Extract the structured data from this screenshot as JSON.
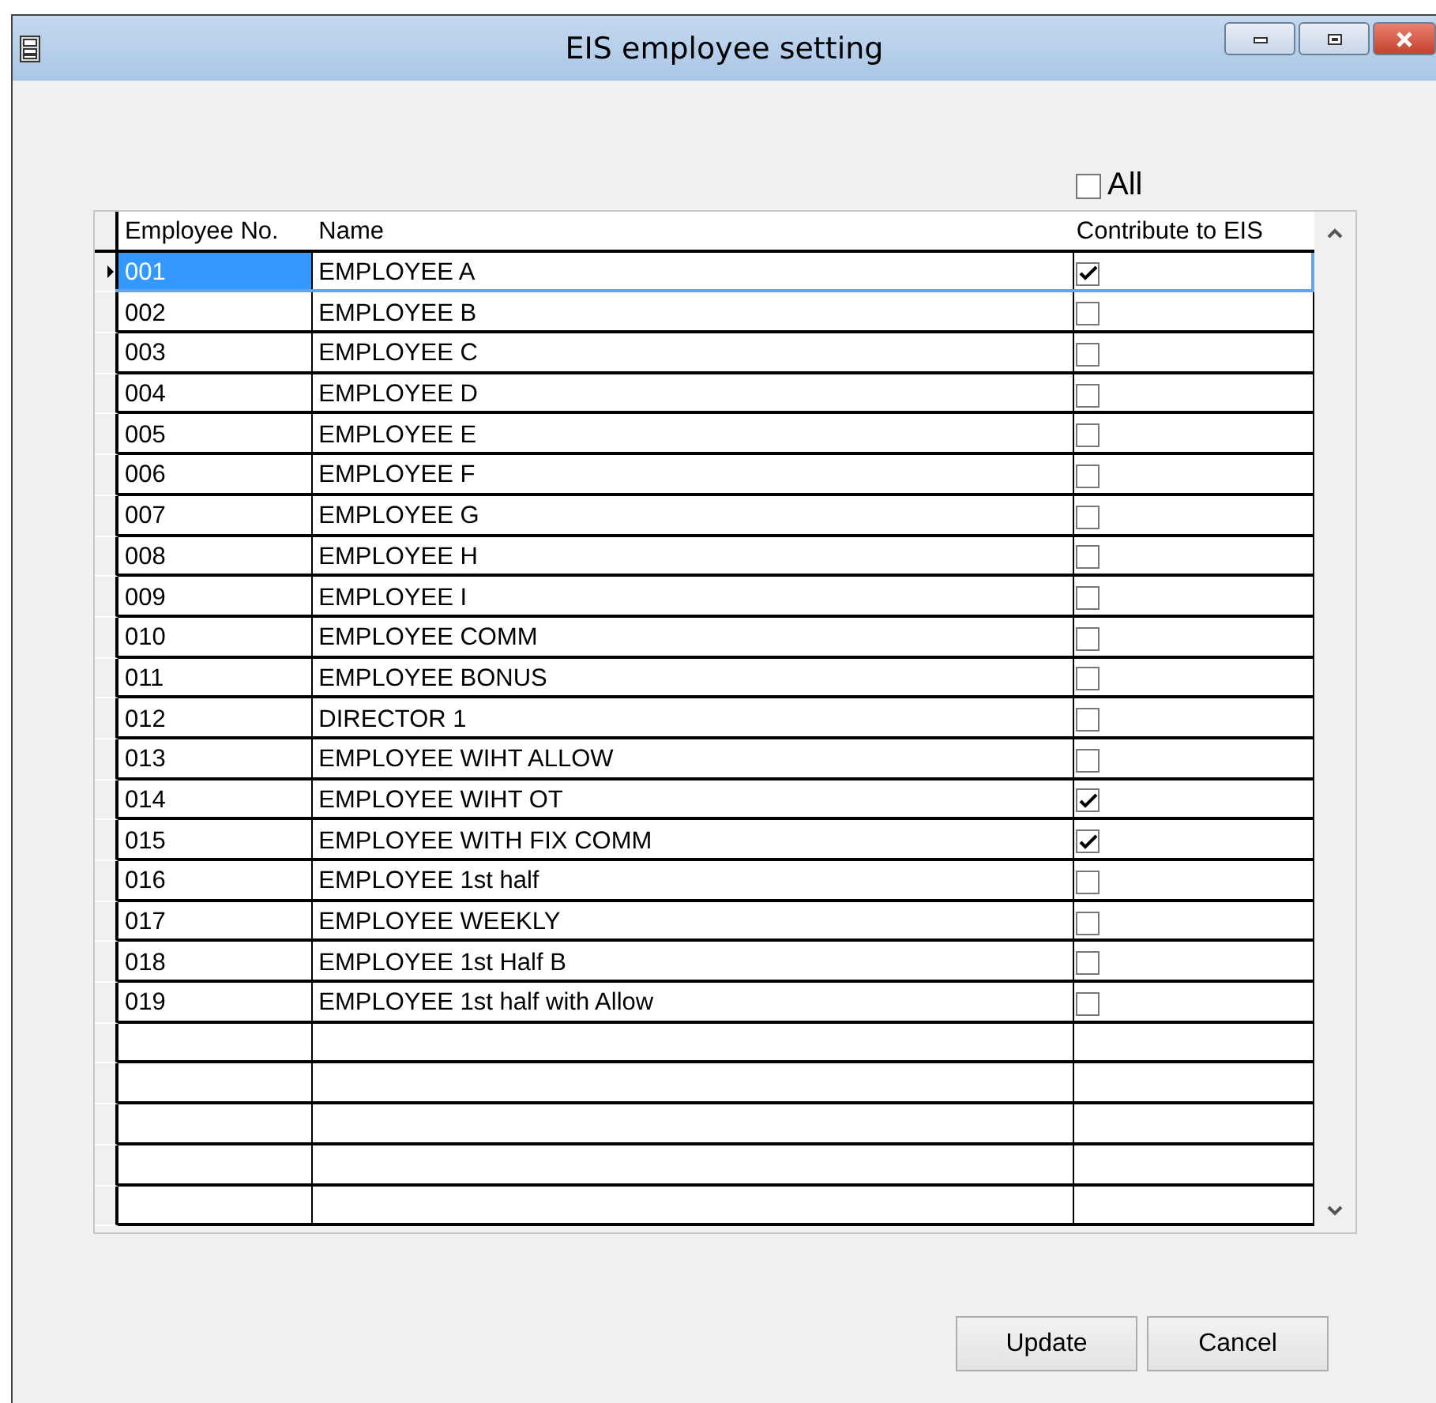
{
  "window": {
    "title": "EIS employee setting"
  },
  "all_checkbox": {
    "label": "All",
    "checked": false
  },
  "table": {
    "columns": [
      "Employee No.",
      "Name",
      "Contribute to EIS"
    ],
    "rows": [
      {
        "employee_no": "001",
        "name": "EMPLOYEE A",
        "contribute": true,
        "selected": true
      },
      {
        "employee_no": "002",
        "name": "EMPLOYEE B",
        "contribute": false,
        "selected": false
      },
      {
        "employee_no": "003",
        "name": "EMPLOYEE C",
        "contribute": false,
        "selected": false
      },
      {
        "employee_no": "004",
        "name": "EMPLOYEE D",
        "contribute": false,
        "selected": false
      },
      {
        "employee_no": "005",
        "name": "EMPLOYEE E",
        "contribute": false,
        "selected": false
      },
      {
        "employee_no": "006",
        "name": "EMPLOYEE F",
        "contribute": false,
        "selected": false
      },
      {
        "employee_no": "007",
        "name": "EMPLOYEE G",
        "contribute": false,
        "selected": false
      },
      {
        "employee_no": "008",
        "name": "EMPLOYEE H",
        "contribute": false,
        "selected": false
      },
      {
        "employee_no": "009",
        "name": "EMPLOYEE I",
        "contribute": false,
        "selected": false
      },
      {
        "employee_no": "010",
        "name": "EMPLOYEE COMM",
        "contribute": false,
        "selected": false
      },
      {
        "employee_no": "011",
        "name": "EMPLOYEE BONUS",
        "contribute": false,
        "selected": false
      },
      {
        "employee_no": "012",
        "name": "DIRECTOR 1",
        "contribute": false,
        "selected": false
      },
      {
        "employee_no": "013",
        "name": "EMPLOYEE WIHT ALLOW",
        "contribute": false,
        "selected": false
      },
      {
        "employee_no": "014",
        "name": "EMPLOYEE WIHT OT",
        "contribute": true,
        "selected": false
      },
      {
        "employee_no": "015",
        "name": "EMPLOYEE WITH FIX COMM",
        "contribute": true,
        "selected": false
      },
      {
        "employee_no": "016",
        "name": "EMPLOYEE 1st half",
        "contribute": false,
        "selected": false
      },
      {
        "employee_no": "017",
        "name": "EMPLOYEE WEEKLY",
        "contribute": false,
        "selected": false
      },
      {
        "employee_no": "018",
        "name": "EMPLOYEE 1st Half B",
        "contribute": false,
        "selected": false
      },
      {
        "employee_no": "019",
        "name": "EMPLOYEE 1st half with Allow",
        "contribute": false,
        "selected": false
      }
    ]
  },
  "buttons": [
    "Update",
    "Cancel"
  ]
}
